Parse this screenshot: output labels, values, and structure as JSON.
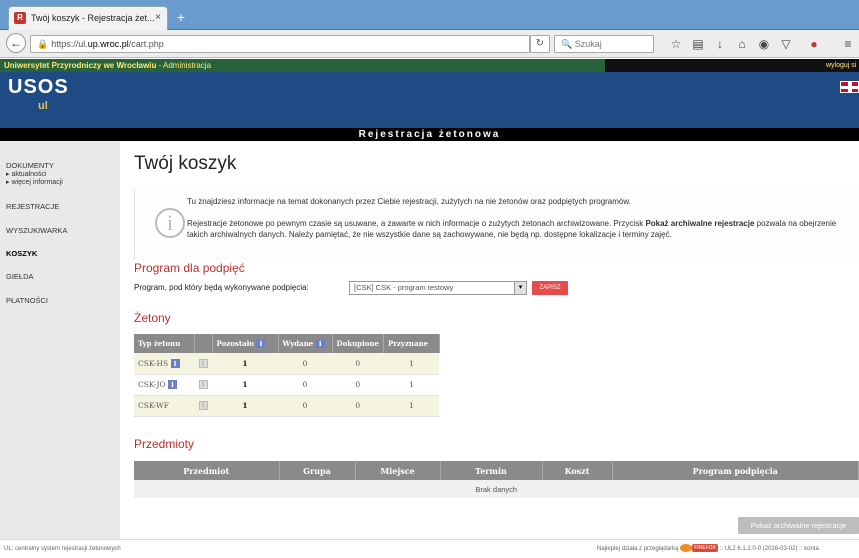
{
  "browser": {
    "tab_title": "Twój koszyk - Rejestracja żet...",
    "tab_close": "×",
    "new_tab": "+",
    "url_prefix": "https://ul.",
    "url_domain": "up.wroc.pl",
    "url_path": "/cart.php",
    "search_placeholder": "Szukaj"
  },
  "topbar": {
    "university": "Uniwersytet Przyrodniczy we Wrocławiu",
    "admin": " - Administracja",
    "logout": "wyloguj si"
  },
  "header": {
    "logo": "USOS",
    "logo_sub": "ul"
  },
  "section_title": "Rejestracja żetonowa",
  "sidebar": {
    "dokumenty": "DOKUMENTY",
    "aktualnosci": "▸ aktualności",
    "wiecej": "▸ więcej informacji",
    "rejestracje": "REJESTRACJE",
    "wyszukiwarka": "WYSZUKIWARKA",
    "koszyk": "KOSZYK",
    "gielda": "GIEŁDA",
    "platnosci": "PŁATNOŚCI"
  },
  "main": {
    "title": "Twój koszyk",
    "info1": "Tu znajdziesz informacje na temat dokonanych przez Ciebie rejestracji, zużytych na nie żetonów oraz podpiętych programów.",
    "info2a": "Rejestracje żetonowe po pewnym czasie są usuwane, a zawarte w nich informacje o zużytych żetonach archiwizowane. Przycisk ",
    "info2b": "Pokaż archiwalne rejestracje",
    "info2c": " pozwala na obejrzenie takich archiwalnych danych. Należy pamiętać, że nie wszystkie dane są zachowywane, nie będą np. dostępne lokalizacje i terminy zajęć.",
    "program_heading": "Program dla podpięć",
    "program_label": "Program, pod który będą wykonywane podpięcia:",
    "program_value": "[CSK] CSK - program testowy",
    "save": "ZAPISZ",
    "tokens_heading": "Żetony",
    "subjects_heading": "Przedmioty",
    "archive_button": "Pokaż archiwalne rejestracje"
  },
  "tokens_table": {
    "headers": [
      "Typ żetonu",
      "",
      "Pozostało",
      "Wydane",
      "Dokupione",
      "Przyznane"
    ],
    "rows": [
      [
        "CSK-HS",
        "1",
        "0",
        "0",
        "1"
      ],
      [
        "CSK-JO",
        "1",
        "0",
        "0",
        "1"
      ],
      [
        "CSK-WF",
        "1",
        "0",
        "0",
        "1"
      ]
    ]
  },
  "subjects_table": {
    "headers": [
      "Przedmiot",
      "Grupa",
      "Miejsce",
      "Termin",
      "Koszt",
      "Program podpięcia"
    ],
    "empty": "Brak danych"
  },
  "footer": {
    "left": "UL: centralny system rejestracji żetonowych",
    "right_a": "Najlepiej działa z przeglądarką",
    "right_badge": "FIREFOX",
    "right_b": ":: UL2 6.1.2.0-0 (2016-03-02) :: konta"
  },
  "colors": {
    "header": "#1f4b85",
    "topbar": "#27623a",
    "accent_red": "#b8312f"
  }
}
